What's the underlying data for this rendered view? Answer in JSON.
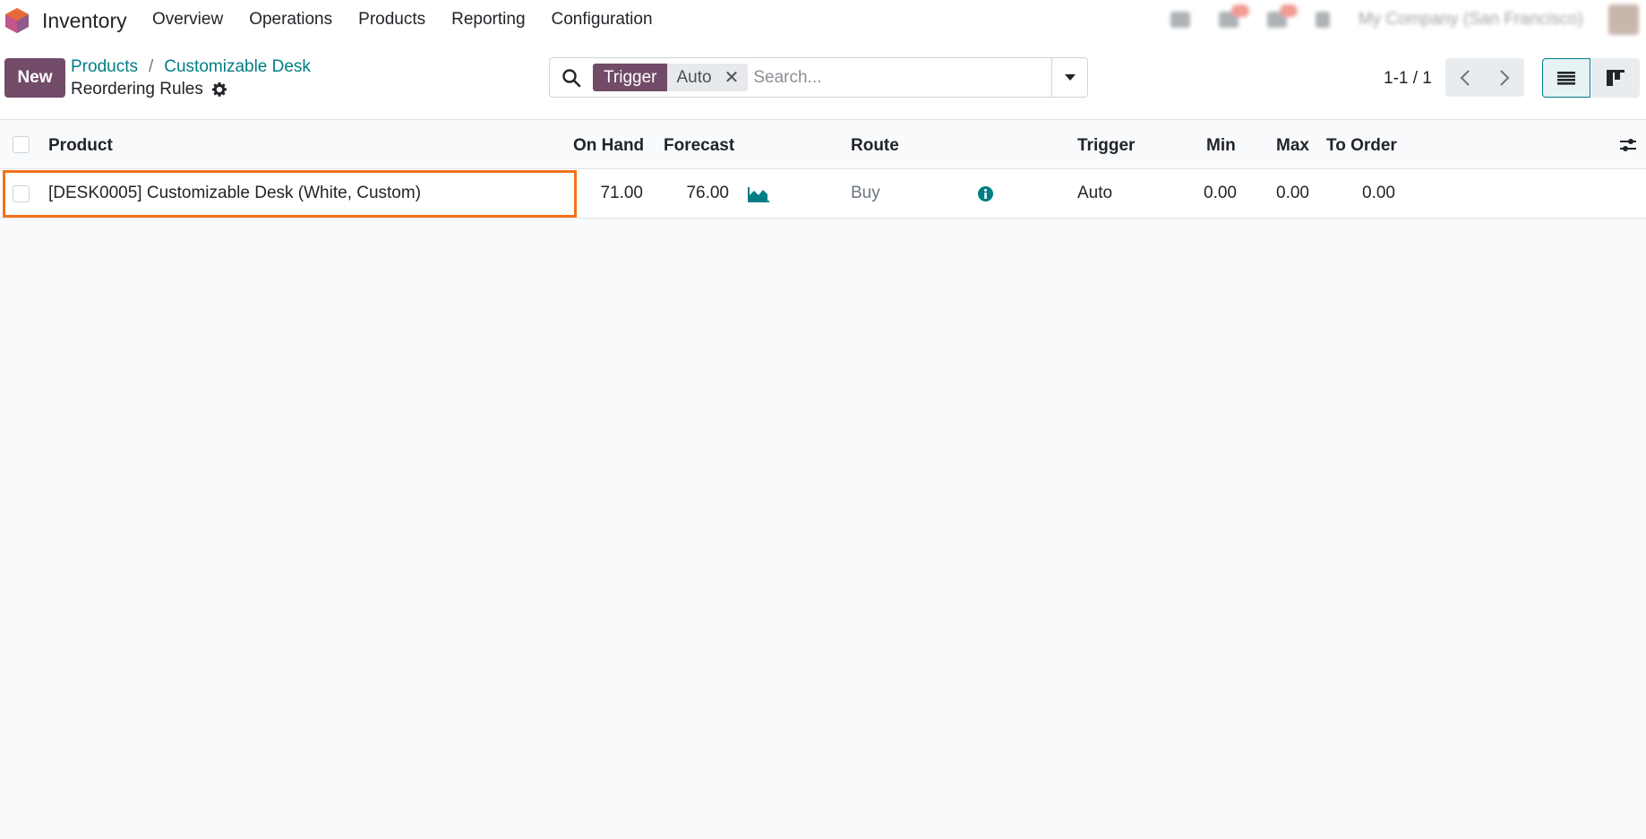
{
  "navbar": {
    "app_name": "Inventory",
    "menu": [
      "Overview",
      "Operations",
      "Products",
      "Reporting",
      "Configuration"
    ],
    "company": "My Company (San Francisco)"
  },
  "control": {
    "new_label": "New",
    "breadcrumb": [
      "Products",
      "Customizable Desk"
    ],
    "breadcrumb_sep": "/",
    "title": "Reordering Rules",
    "search": {
      "facet_label": "Trigger",
      "facet_value": "Auto",
      "placeholder": "Search..."
    },
    "pager": "1-1 / 1"
  },
  "table": {
    "columns": {
      "product": "Product",
      "on_hand": "On Hand",
      "forecast": "Forecast",
      "route": "Route",
      "trigger": "Trigger",
      "min": "Min",
      "max": "Max",
      "to_order": "To Order"
    },
    "rows": [
      {
        "product": "[DESK0005] Customizable Desk (White, Custom)",
        "on_hand": "71.00",
        "forecast": "76.00",
        "route": "Buy",
        "trigger": "Auto",
        "min": "0.00",
        "max": "0.00",
        "to_order": "0.00"
      }
    ]
  },
  "colors": {
    "brand": "#714b67",
    "link": "#017e84",
    "highlight": "#f4711a"
  }
}
